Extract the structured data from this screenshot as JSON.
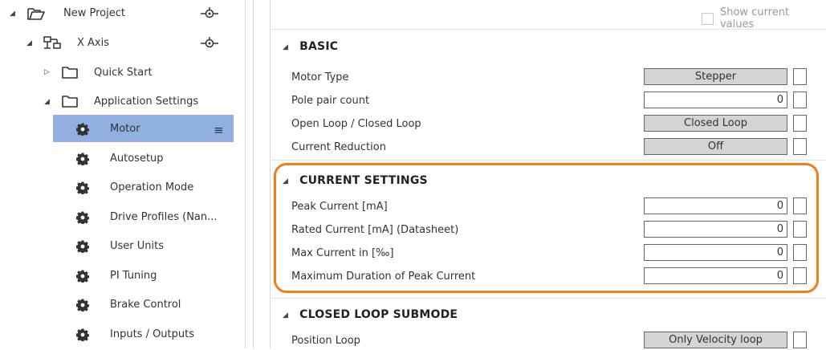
{
  "tree": {
    "project": {
      "label": "New Project",
      "icon": "folder-open-icon"
    },
    "axis": {
      "label": "X Axis",
      "icon": "axis-icon"
    },
    "quick_start": {
      "label": "Quick Start",
      "icon": "folder-icon"
    },
    "app_settings": {
      "label": "Application Settings",
      "icon": "folder-open-icon"
    },
    "items": [
      {
        "label": "Motor",
        "icon": "gear-icon",
        "selected": true
      },
      {
        "label": "Autosetup",
        "icon": "gear-icon"
      },
      {
        "label": "Operation Mode",
        "icon": "gear-icon"
      },
      {
        "label": "Drive Profiles (Nan...",
        "icon": "gear-icon"
      },
      {
        "label": "User Units",
        "icon": "gear-icon"
      },
      {
        "label": "PI Tuning",
        "icon": "gear-icon"
      },
      {
        "label": "Brake Control",
        "icon": "gear-icon"
      },
      {
        "label": "Inputs / Outputs",
        "icon": "gear-icon"
      }
    ]
  },
  "main": {
    "show_current_values": "Show current values",
    "basic": {
      "title": "BASIC",
      "rows": [
        {
          "label": "Motor Type",
          "value": "Stepper",
          "kind": "button"
        },
        {
          "label": "Pole pair count",
          "value": "0",
          "kind": "number"
        },
        {
          "label": "Open Loop / Closed Loop",
          "value": "Closed Loop",
          "kind": "button"
        },
        {
          "label": "Current Reduction",
          "value": "Off",
          "kind": "button"
        }
      ]
    },
    "current": {
      "title": "CURRENT SETTINGS",
      "rows": [
        {
          "label": "Peak Current [mA]",
          "value": "0",
          "kind": "number"
        },
        {
          "label": "Rated Current [mA] (Datasheet)",
          "value": "0",
          "kind": "number"
        },
        {
          "label": "Max Current in  [‰]",
          "value": "0",
          "kind": "number"
        },
        {
          "label": "Maximum Duration of Peak Current",
          "value": "0",
          "kind": "number"
        }
      ]
    },
    "closed_loop": {
      "title": "CLOSED LOOP SUBMODE",
      "rows": [
        {
          "label": "Position Loop",
          "value": "Only Velocity loop",
          "kind": "button"
        }
      ]
    }
  },
  "colors": {
    "selection": "#8fb0e0",
    "highlight": "#f07e1e"
  }
}
